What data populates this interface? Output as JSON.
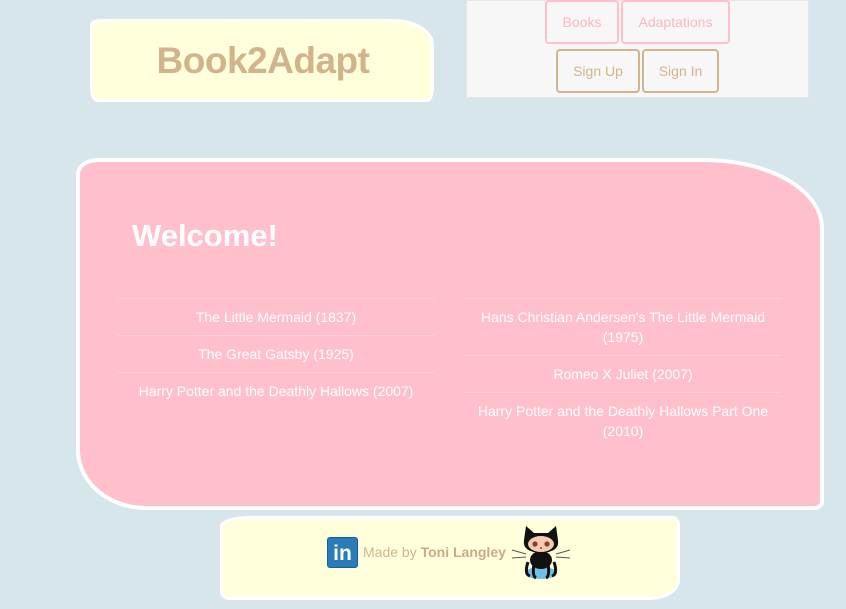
{
  "header": {
    "logo_text": "Book2Adapt"
  },
  "nav": {
    "books": "Books",
    "adaptations": "Adaptations",
    "sign_up": "Sign Up",
    "sign_in": "Sign In"
  },
  "main": {
    "heading": "Welcome!",
    "books": [
      "The Little Mermaid (1837)",
      "The Great Gatsby (1925)",
      "Harry Potter and the Deathly Hallows (2007)"
    ],
    "adaptations": [
      "Hans Christian Andersen's The Little Mermaid (1975)",
      "Romeo X Juliet (2007)",
      "Harry Potter and the Deathly Hallows Part One (2010)"
    ]
  },
  "footer": {
    "made_by": "Made by",
    "author": "Toni Langley",
    "linkedin_glyph": "in",
    "icons": [
      "linkedin-icon",
      "github-octocat-icon"
    ]
  },
  "colors": {
    "background": "#d6e6ea",
    "cream": "#ffffdc",
    "pink": "#ffc0cb",
    "tan": "#d2b48c"
  }
}
